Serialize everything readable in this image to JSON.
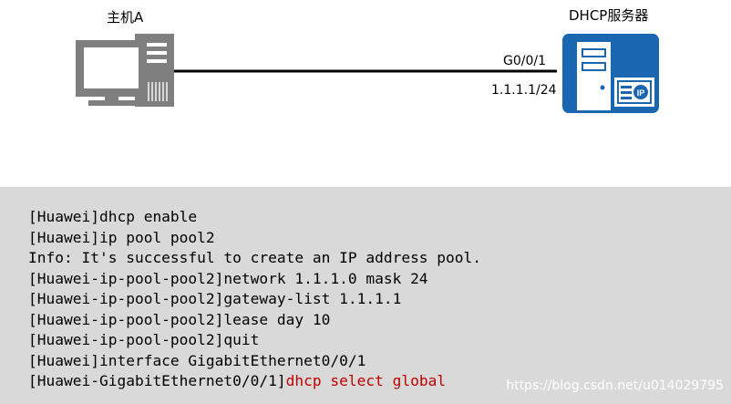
{
  "diagram": {
    "host": {
      "label": "主机A"
    },
    "server": {
      "label": "DHCP服务器"
    },
    "link": {
      "port": "G0/0/1",
      "ip": "1.1.1.1/24"
    },
    "colors": {
      "server_fill": "#1a66b0",
      "pc_fill": "#7f7f7f",
      "link": "#000000",
      "cli_background": "#d9d9d9",
      "highlight": "#c00000"
    },
    "icons": {
      "host": "desktop-pc-icon",
      "server": "dhcp-server-icon"
    }
  },
  "cli": {
    "lines": [
      {
        "prompt": "[Huawei]dhcp enable",
        "command": ""
      },
      {
        "prompt": "[Huawei]ip pool pool2",
        "command": ""
      },
      {
        "prompt": "Info: It's successful to create an IP address pool.",
        "command": ""
      },
      {
        "prompt": "[Huawei-ip-pool-pool2]network 1.1.1.0 mask 24",
        "command": ""
      },
      {
        "prompt": "[Huawei-ip-pool-pool2]gateway-list 1.1.1.1",
        "command": ""
      },
      {
        "prompt": "[Huawei-ip-pool-pool2]lease day 10",
        "command": ""
      },
      {
        "prompt": "[Huawei-ip-pool-pool2]quit",
        "command": ""
      },
      {
        "prompt": "[Huawei]interface GigabitEthernet0/0/1",
        "command": ""
      },
      {
        "prompt": "[Huawei-GigabitEthernet0/0/1]",
        "command": "dhcp select global"
      }
    ]
  },
  "watermark": "https://blog.csdn.net/u014029795"
}
